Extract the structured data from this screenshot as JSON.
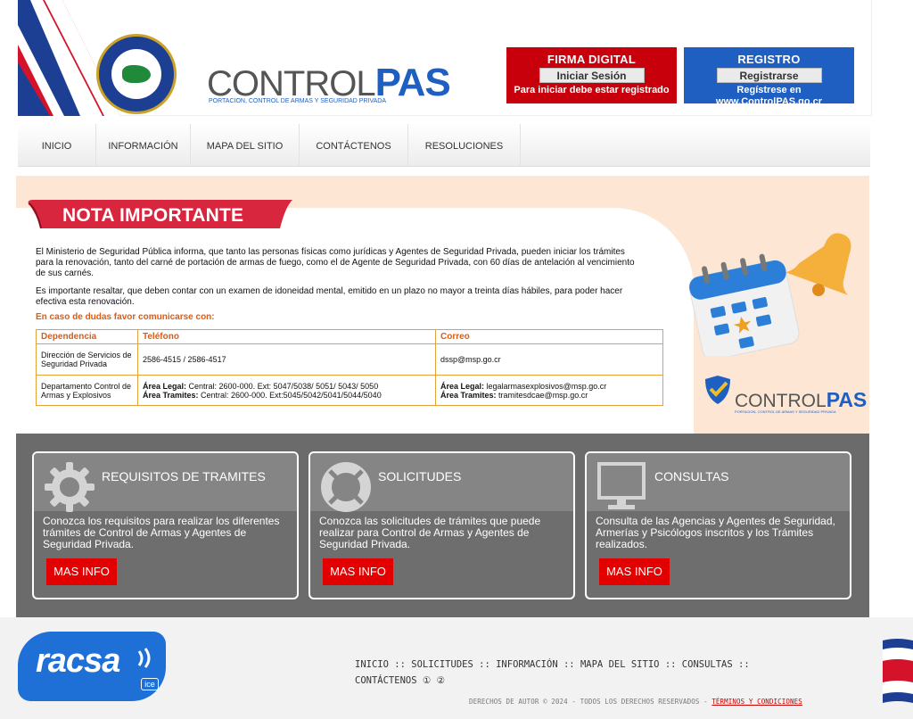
{
  "header": {
    "logo_text_a": "CONTROL",
    "logo_text_b": "PAS",
    "logo_tagline": "PORTACION, CONTROL DE ARMAS Y SEGURIDAD PRIVADA",
    "seal_label": "MINISTERIO DE SEGURIDAD PÚBLICA · COSTA RICA",
    "firma": {
      "title": "FIRMA DIGITAL",
      "button": "Iniciar Sesión",
      "sub": "Para iniciar debe estar registrado"
    },
    "registro": {
      "title": "REGISTRO",
      "button": "Registrarse",
      "sub": "Regístrese en www.ControlPAS.go.cr"
    }
  },
  "nav": [
    "INICIO",
    "INFORMACIÓN",
    "MAPA DEL SITIO",
    "CONTÁCTENOS",
    "RESOLUCIONES"
  ],
  "notice": {
    "title": "NOTA IMPORTANTE",
    "p1": "El Ministerio de Seguridad Pública informa, que tanto las personas físicas como jurídicas y Agentes de Seguridad Privada, pueden iniciar los trámites para la renovación, tanto del carné de portación de armas de fuego, como el de Agente de Seguridad Privada, con 60 días de antelación al vencimiento de sus carnés.",
    "p2": "Es importante resaltar, que deben contar con un examen de idoneidad mental, emitido en un plazo no mayor a treinta días hábiles, para poder hacer efectiva esta renovación.",
    "p3": "En caso de dudas favor comunicarse con:",
    "table": {
      "headers": [
        "Dependencia",
        "Teléfono",
        "Correo"
      ],
      "row1": {
        "dep": "Dirección de Servicios de Seguridad Privada",
        "tel": "2586-4515 / 2586-4517",
        "mail": "dssp@msp.go.cr"
      },
      "row2": {
        "dep": "Departamento Control de Armas y Explosivos",
        "tel1_label": "Área Legal:",
        "tel1": " Central: 2600-000. Ext: 5047/5038/ 5051/ 5043/ 5050",
        "tel2_label": "Área Tramites:",
        "tel2": " Central: 2600-000. Ext:5045/5042/5041/5044/5040",
        "mail1_label": "Área Legal:",
        "mail1": " legalarmasexplosivos@msp.go.cr",
        "mail2_label": "Área Tramites:",
        "mail2": " tramitesdcae@msp.go.cr"
      }
    },
    "logo_a": "CONTROL",
    "logo_b": "PAS",
    "logo_tag": "PORTACION, CONTROL DE ARMAS Y SEGURIDAD PRIVADA"
  },
  "cards": [
    {
      "title": "REQUISITOS DE TRAMITES",
      "desc": "Conozca los requisitos para realizar los diferentes trámites de Control de Armas y Agentes de Seguridad Privada.",
      "button": "MAS INFO",
      "icon": "gear-icon"
    },
    {
      "title": "SOLICITUDES",
      "desc": "Conozca las solicitudes de trámites que puede realizar para Control de Armas y Agentes de Seguridad Privada.",
      "button": "MAS INFO",
      "icon": "lifebuoy-icon"
    },
    {
      "title": "CONSULTAS",
      "desc": "Consulta de las Agencias y Agentes de Seguridad, Armerías y Psicólogos inscritos y los Trámites realizados.",
      "button": "MAS INFO",
      "icon": "monitor-icon"
    }
  ],
  "footer": {
    "racsa": "racsa",
    "ice": "ice",
    "links": [
      "INICIO",
      "SOLICITUDES",
      "INFORMACIÓN",
      "MAPA DEL SITIO",
      "CONSULTAS",
      "CONTÁCTENOS"
    ],
    "sep": "::",
    "badges": "① ②",
    "copyright": "DERECHOS DE AUTOR © 2024 - TODOS LOS DERECHOS RESERVADOS - ",
    "terms": "TÉRMINOS Y CONDICIONES"
  },
  "colors": {
    "red": "#c8000c",
    "blue": "#1e5fc1",
    "orange": "#e05a10",
    "cr_blue": "#1d3f93",
    "cr_red": "#d4122a"
  }
}
